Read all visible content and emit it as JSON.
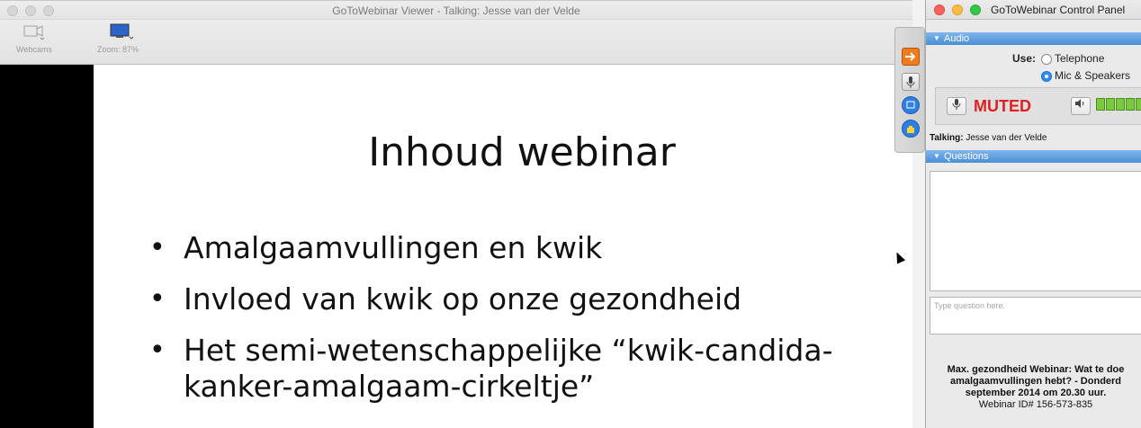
{
  "viewer": {
    "title": "GoToWebinar Viewer - Talking: Jesse van der Velde",
    "toolbar": {
      "webcams_label": "Webcams",
      "zoom_label": "Zoom: 87%"
    }
  },
  "slide": {
    "title": "Inhoud webinar",
    "bullets": [
      "Amalgaamvullingen en kwik",
      "Invloed van kwik op onze gezondheid",
      "Het semi-wetenschappelijke “kwik-candida-kanker-amalgaam-cirkeltje”"
    ]
  },
  "panel": {
    "title": "GoToWebinar Control Panel",
    "audio": {
      "header": "Audio",
      "use_label": "Use:",
      "options": [
        "Telephone",
        "Mic & Speakers"
      ],
      "selected": "Mic & Speakers",
      "muted_label": "MUTED",
      "talking_label": "Talking:",
      "talking_name": "Jesse van der Velde"
    },
    "questions": {
      "header": "Questions",
      "placeholder": "Type question here."
    },
    "webinar": {
      "title_line1": "Max. gezondheid Webinar: Wat te doe",
      "title_line2": "amalgaamvullingen hebt? - Donderd",
      "title_line3": "september 2014 om 20.30 uur.",
      "id_line": "Webinar ID# 156-573-835"
    }
  },
  "colors": {
    "accent_blue": "#4a8fd6",
    "muted_red": "#e02020",
    "meter_green": "#7acb3b"
  }
}
